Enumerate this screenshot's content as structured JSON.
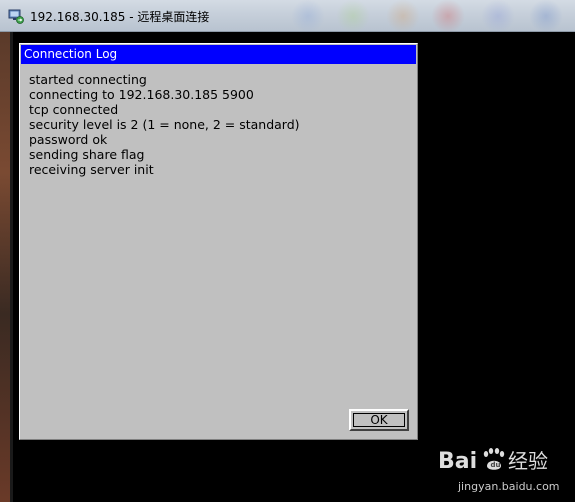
{
  "window": {
    "title": "192.168.30.185 - 远程桌面连接",
    "icon": "remote-desktop-icon"
  },
  "dialog": {
    "title": "Connection Log",
    "log_lines": [
      "started connecting",
      "connecting to 192.168.30.185 5900",
      "tcp connected",
      "security level is 2 (1 = none, 2 = standard)",
      "password ok",
      "sending share flag",
      "receiving server init"
    ],
    "ok_label": "OK"
  },
  "watermark": {
    "brand": "Bai",
    "brand_suffix": "经验",
    "url": "jingyan.baidu.com"
  },
  "colors": {
    "dialog_title_bg": "#0000ff",
    "dialog_bg": "#c0c0c0",
    "desktop_bg": "#000000"
  }
}
